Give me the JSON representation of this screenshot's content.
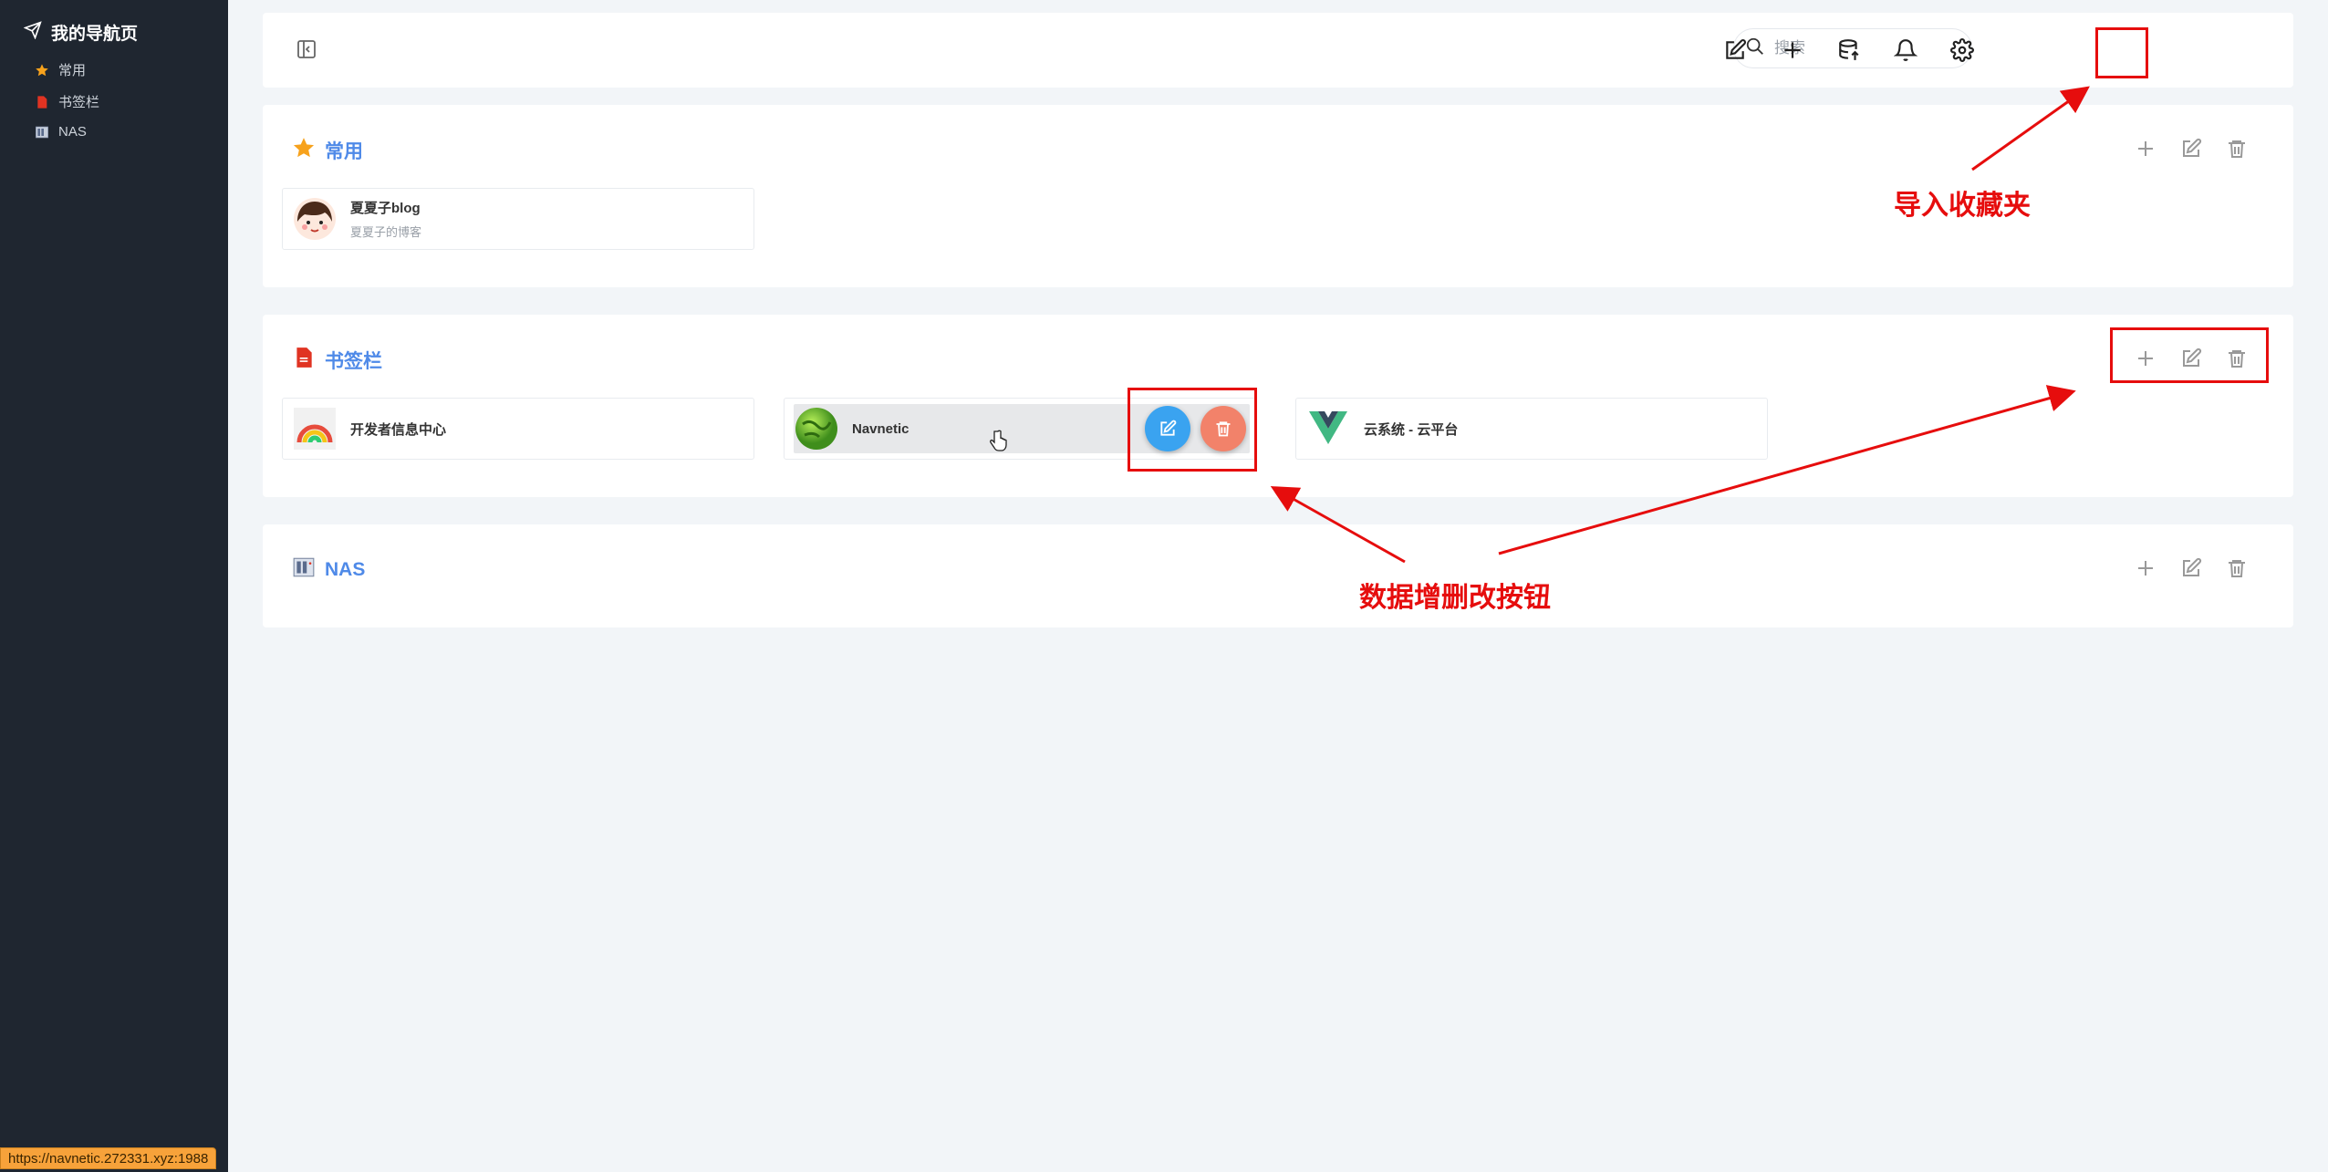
{
  "sidebar": {
    "brand": "我的导航页",
    "items": [
      {
        "label": "常用",
        "icon": "star-icon"
      },
      {
        "label": "书签栏",
        "icon": "document-icon"
      },
      {
        "label": "NAS",
        "icon": "nas-icon"
      }
    ]
  },
  "statusbar": {
    "url": "https://navnetic.272331.xyz:1988"
  },
  "header": {
    "search_placeholder": "搜索",
    "buttons": [
      "edit-icon",
      "plus-icon",
      "database-import-icon",
      "bell-icon",
      "settings-icon"
    ]
  },
  "sections": [
    {
      "title": "常用",
      "icon": "star-icon",
      "cards": [
        {
          "name": "夏夏子blog",
          "desc": "夏夏子的博客"
        }
      ]
    },
    {
      "title": "书签栏",
      "icon": "document-icon",
      "cards": [
        {
          "name": "开发者信息中心",
          "desc": ""
        },
        {
          "name": "Navnetic",
          "desc": ""
        },
        {
          "name": "云系统 - 云平台",
          "desc": ""
        }
      ]
    },
    {
      "title": "NAS",
      "icon": "nas-icon",
      "cards": []
    }
  ],
  "annotations": {
    "import": "导入收藏夹",
    "crud": "数据增删改按钮"
  },
  "colors": {
    "sidebar_bg": "#1f2630",
    "accent": "#4f8ae8",
    "edit_button": "#3aa3f0",
    "delete_button": "#f2826a",
    "annotation_red": "#e60d0d"
  }
}
